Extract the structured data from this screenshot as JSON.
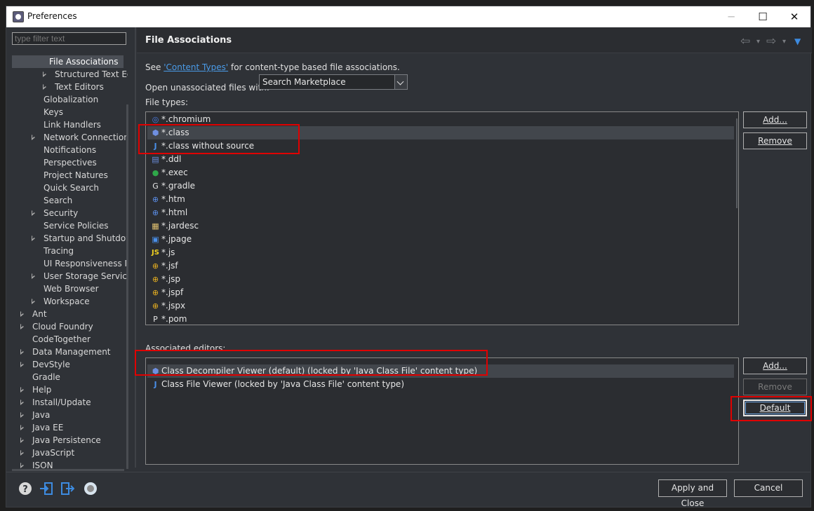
{
  "window": {
    "title": "Preferences",
    "min_glyph": "─",
    "max_glyph": "☐",
    "close_glyph": "✕"
  },
  "filter": {
    "placeholder": "type filter text"
  },
  "tree": {
    "items": [
      {
        "label": "File Associations",
        "indent": 3,
        "selected": true,
        "expandable": false
      },
      {
        "label": "Structured Text Edit",
        "indent": 3,
        "expandable": true
      },
      {
        "label": "Text Editors",
        "indent": 3,
        "expandable": true
      },
      {
        "label": "Globalization",
        "indent": 2
      },
      {
        "label": "Keys",
        "indent": 2
      },
      {
        "label": "Link Handlers",
        "indent": 2
      },
      {
        "label": "Network Connections",
        "indent": 2,
        "expandable": true
      },
      {
        "label": "Notifications",
        "indent": 2
      },
      {
        "label": "Perspectives",
        "indent": 2
      },
      {
        "label": "Project Natures",
        "indent": 2
      },
      {
        "label": "Quick Search",
        "indent": 2
      },
      {
        "label": "Search",
        "indent": 2
      },
      {
        "label": "Security",
        "indent": 2,
        "expandable": true
      },
      {
        "label": "Service Policies",
        "indent": 2
      },
      {
        "label": "Startup and Shutdown",
        "indent": 2,
        "expandable": true
      },
      {
        "label": "Tracing",
        "indent": 2
      },
      {
        "label": "UI Responsiveness Mor",
        "indent": 2
      },
      {
        "label": "User Storage Service",
        "indent": 2,
        "expandable": true
      },
      {
        "label": "Web Browser",
        "indent": 2
      },
      {
        "label": "Workspace",
        "indent": 2,
        "expandable": true
      },
      {
        "label": "Ant",
        "indent": 1,
        "expandable": true
      },
      {
        "label": "Cloud Foundry",
        "indent": 1,
        "expandable": true
      },
      {
        "label": "CodeTogether",
        "indent": 1
      },
      {
        "label": "Data Management",
        "indent": 1,
        "expandable": true
      },
      {
        "label": "DevStyle",
        "indent": 1,
        "expandable": true
      },
      {
        "label": "Gradle",
        "indent": 1
      },
      {
        "label": "Help",
        "indent": 1,
        "expandable": true
      },
      {
        "label": "Install/Update",
        "indent": 1,
        "expandable": true
      },
      {
        "label": "Java",
        "indent": 1,
        "expandable": true
      },
      {
        "label": "Java EE",
        "indent": 1,
        "expandable": true
      },
      {
        "label": "Java Persistence",
        "indent": 1,
        "expandable": true
      },
      {
        "label": "JavaScript",
        "indent": 1,
        "expandable": true
      },
      {
        "label": "JSON",
        "indent": 1,
        "expandable": true
      }
    ]
  },
  "header": {
    "title": "File Associations",
    "back_glyph": "⇦",
    "forward_glyph": "⇨",
    "dropdown_glyph": "▾",
    "menu_glyph": "▼"
  },
  "content": {
    "see_prefix": "See ",
    "content_types_link": "'Content Types'",
    "see_suffix": " for content-type based file associations.",
    "open_unassociated_label": "Open unassociated files with:",
    "open_unassociated_value": "Search Marketplace",
    "file_types_label": "File types:",
    "associated_editors_label": "Associated editors:"
  },
  "file_types": [
    {
      "name": "*.chromium",
      "icon": "chromium-icon",
      "glyph": "◎",
      "color": "#4a7de8"
    },
    {
      "name": "*.class",
      "icon": "class-cube-icon",
      "glyph": "⬢",
      "color": "#6f8fe0",
      "selected": true
    },
    {
      "name": "*.class without source",
      "icon": "java-j-icon",
      "glyph": "J",
      "color": "#4a8fe8"
    },
    {
      "name": "*.ddl",
      "icon": "database-icon",
      "glyph": "▤",
      "color": "#6b8fe0"
    },
    {
      "name": "*.exec",
      "icon": "exec-icon",
      "glyph": "●",
      "color": "#2fa84a"
    },
    {
      "name": "*.gradle",
      "icon": "gradle-file-icon",
      "glyph": "G",
      "color": "#e6e6e6"
    },
    {
      "name": "*.htm",
      "icon": "globe-icon",
      "glyph": "⊕",
      "color": "#5b8ee8"
    },
    {
      "name": "*.html",
      "icon": "globe-icon",
      "glyph": "⊕",
      "color": "#5b8ee8"
    },
    {
      "name": "*.jardesc",
      "icon": "jardesc-icon",
      "glyph": "▦",
      "color": "#e0c070"
    },
    {
      "name": "*.jpage",
      "icon": "scrapbook-icon",
      "glyph": "▣",
      "color": "#4a8fe8"
    },
    {
      "name": "*.js",
      "icon": "javascript-icon",
      "glyph": "JS",
      "color": "#f0d020"
    },
    {
      "name": "*.jsf",
      "icon": "jsp-globe-icon",
      "glyph": "⊕",
      "color": "#e8b020"
    },
    {
      "name": "*.jsp",
      "icon": "jsp-globe-icon",
      "glyph": "⊕",
      "color": "#e8b020"
    },
    {
      "name": "*.jspf",
      "icon": "jsp-globe-icon",
      "glyph": "⊕",
      "color": "#e8b020"
    },
    {
      "name": "*.jspx",
      "icon": "jsp-globe-icon",
      "glyph": "⊕",
      "color": "#e8b020"
    },
    {
      "name": "*.pom",
      "icon": "pom-file-icon",
      "glyph": "P",
      "color": "#e6e6e6"
    }
  ],
  "editors": [
    {
      "name": "Class Decompiler Viewer (default) (locked by 'Java Class File' content type)",
      "icon": "class-cube-icon",
      "glyph": "⬢",
      "color": "#6f8fe0",
      "selected": true
    },
    {
      "name": "Class File Viewer (locked by 'Java Class File' content type)",
      "icon": "java-j-icon",
      "glyph": "J",
      "color": "#4a8fe8"
    }
  ],
  "buttons": {
    "file_add": "Add...",
    "file_remove": "Remove",
    "editor_add": "Add...",
    "editor_remove": "Remove",
    "editor_default": "Default",
    "apply_close": "Apply and Close",
    "cancel": "Cancel"
  },
  "footer_icons": [
    {
      "name": "help-icon",
      "glyph": "?"
    },
    {
      "name": "import-icon",
      "glyph": "⇥"
    },
    {
      "name": "export-icon",
      "glyph": "⇨"
    },
    {
      "name": "oomph-record-icon",
      "glyph": "●"
    }
  ],
  "colors": {
    "accent_link": "#4a9be8",
    "highlight_box": "#e00000",
    "background": "#2f3237"
  }
}
